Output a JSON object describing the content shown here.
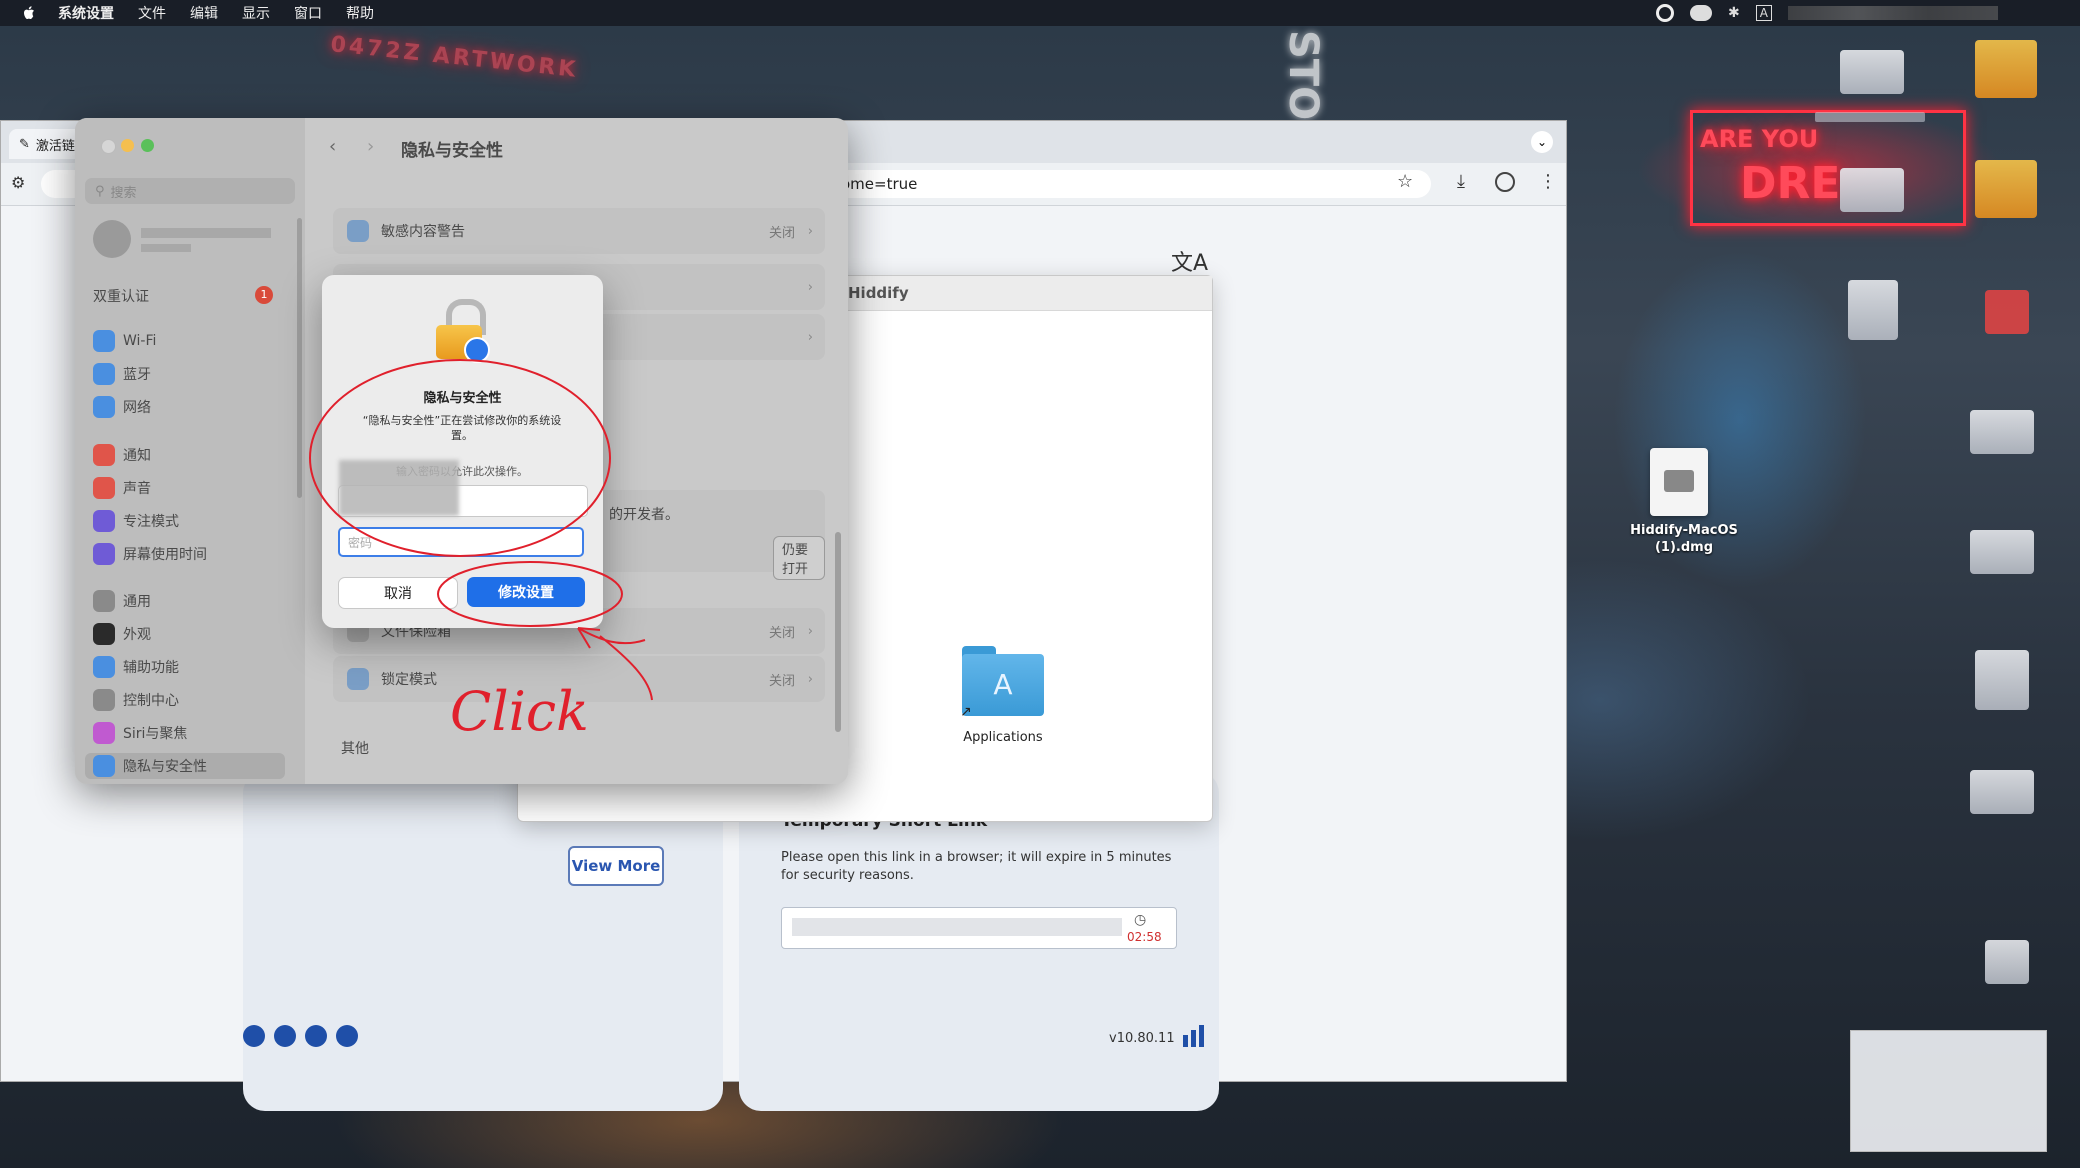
{
  "menubar": {
    "app_name": "系统设置",
    "items": [
      "文件",
      "编辑",
      "显示",
      "窗口",
      "帮助"
    ]
  },
  "wallpaper": {
    "neon_text_1": "0472Z ARTWORK",
    "neon_text_2": "STO",
    "neon_text_3": "ARE YOU",
    "neon_text_4": "DRE"
  },
  "browser": {
    "tab_title": "激活链",
    "url": "ome=true",
    "finder_title": "Hiddify",
    "applications_label": "Applications",
    "view_more": "View More",
    "short_link_title": "Temporary Short Link",
    "short_link_desc": "Please open this link in a browser; it will expire in 5 minutes for security reasons.",
    "timer": "02:58",
    "version": "v10.80.11"
  },
  "settings": {
    "title": "隐私与安全性",
    "search_placeholder": "搜索",
    "two_factor": "双重认证",
    "two_factor_badge": "1",
    "sidebar": [
      {
        "label": "Wi-Fi",
        "color": "#4a8fe0",
        "icon": "wifi-icon"
      },
      {
        "label": "蓝牙",
        "color": "#4a8fe0",
        "icon": "bluetooth-icon"
      },
      {
        "label": "网络",
        "color": "#4a8fe0",
        "icon": "globe-icon"
      },
      {
        "label": "通知",
        "color": "#e0554a",
        "icon": "bell-icon"
      },
      {
        "label": "声音",
        "color": "#e0554a",
        "icon": "speaker-icon"
      },
      {
        "label": "专注模式",
        "color": "#6f5bd6",
        "icon": "moon-icon"
      },
      {
        "label": "屏幕使用时间",
        "color": "#6f5bd6",
        "icon": "hourglass-icon"
      },
      {
        "label": "通用",
        "color": "#8a8a8a",
        "icon": "gear-icon"
      },
      {
        "label": "外观",
        "color": "#2a2a2a",
        "icon": "appearance-icon"
      },
      {
        "label": "辅助功能",
        "color": "#4a8fe0",
        "icon": "accessibility-icon"
      },
      {
        "label": "控制中心",
        "color": "#8a8a8a",
        "icon": "control-center-icon"
      },
      {
        "label": "Siri与聚焦",
        "color": "#c05ad0",
        "icon": "siri-icon"
      },
      {
        "label": "隐私与安全性",
        "color": "#4a8fe0",
        "icon": "hand-icon"
      }
    ],
    "rows": {
      "sensitive": "敏感内容警告",
      "sensitive_value": "关闭",
      "developer_text": "的开发者。",
      "open_anyway": "仍要打开",
      "filevault": "文件保险箱",
      "filevault_value": "关闭",
      "lockdown": "锁定模式",
      "lockdown_value": "关闭",
      "other": "其他"
    }
  },
  "dialog": {
    "title": "隐私与安全性",
    "message": "“隐私与安全性”正在尝试修改你的系统设置。",
    "prompt": "输入密码以允许此次操作。",
    "password_placeholder": "密码",
    "cancel": "取消",
    "confirm": "修改设置"
  },
  "annotation": {
    "text": "Click"
  },
  "desktop": {
    "file_name": "Hiddify-MacOS (1).dmg"
  },
  "colors": {
    "accent": "#1f6fe8",
    "annotation_red": "#e0202c"
  }
}
